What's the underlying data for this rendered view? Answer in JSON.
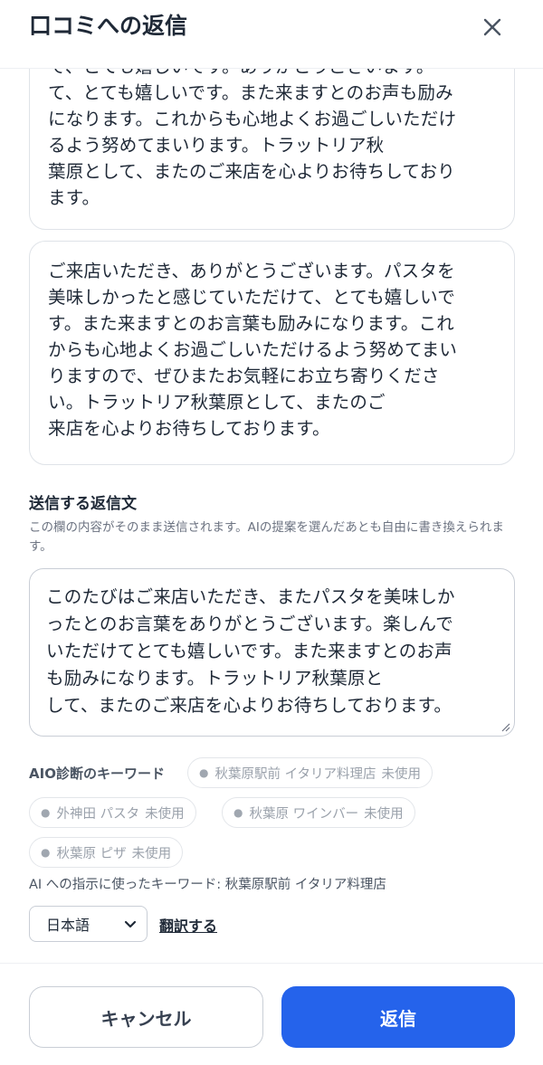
{
  "header": {
    "title": "口コミへの返信",
    "close_icon": "close-icon"
  },
  "suggestions": [
    {
      "text": "で、とても嬉しいです。ありがとうございます。\nて、とても嬉しいです。また来ますとのお声も励み\nになります。これからも心地よくお過ごしいただけ\nるよう努めてまいります。トラットリア秋\n葉原として、またのご来店を心よりお待ちしており\nます。"
    },
    {
      "text": "ご来店いただき、ありがとうございます。パスタを\n美味しかったと感じていただけて、とても嬉しいで\nす。また来ますとのお言葉も励みになります。これ\nからも心地よくお過ごしいただけるよう努めてまい\nりますので、ぜひまたお気軽にお立ち寄りくださ\nい。トラットリア秋葉原として、またのご\n来店を心よりお待ちしております。"
    }
  ],
  "reply": {
    "label": "送信する返信文",
    "helper": "この欄の内容がそのまま送信されます。AIの提案を選んだあとも自由に書き換えられます。",
    "value": "このたびはご来店いただき、またパスタを美味しか\nったとのお言葉をありがとうございます。楽しんで\nいただけてとても嬉しいです。また来ますとのお声\nも励みになります。トラットリア秋葉原と\nして、またのご来店を心よりお待ちしております。"
  },
  "aio": {
    "label": "AIO診断のキーワード",
    "keywords": [
      {
        "keyword": "秋葉原駅前 イタリア料理店",
        "status": "未使用"
      },
      {
        "keyword": "外神田 パスタ",
        "status": "未使用"
      },
      {
        "keyword": "秋葉原 ワインバー",
        "status": "未使用"
      },
      {
        "keyword": "秋葉原 ピザ",
        "status": "未使用"
      }
    ],
    "used_keywords": "AI への指示に使ったキーワード: 秋葉原駅前 イタリア料理店"
  },
  "language": {
    "selected": "日本語",
    "translate_label": "翻訳する"
  },
  "footer": {
    "cancel_label": "キャンセル",
    "reply_label": "返信"
  },
  "colors": {
    "primary": "#2563eb",
    "text": "#1f2937",
    "muted": "#6b7280",
    "border": "#c9ced6"
  }
}
